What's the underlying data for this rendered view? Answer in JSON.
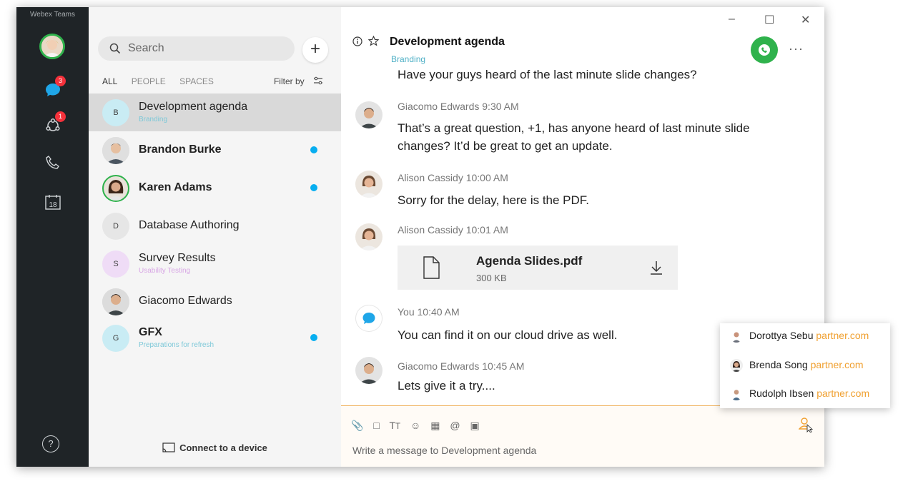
{
  "app": {
    "name": "Webex Teams"
  },
  "rail": {
    "messages_badge": "3",
    "teams_badge": "1",
    "calendar_day": "18",
    "help_glyph": "?"
  },
  "sidebar": {
    "search_placeholder": "Search",
    "add_label": "+",
    "filters": [
      "ALL",
      "PEOPLE",
      "SPACES"
    ],
    "filter_by": "Filter by",
    "items": [
      {
        "initial": "B",
        "name": "Development agenda",
        "sub": "Branding"
      },
      {
        "name": "Brandon Burke"
      },
      {
        "name": "Karen Adams"
      },
      {
        "initial": "D",
        "name": "Database Authoring"
      },
      {
        "initial": "S",
        "name": "Survey Results",
        "sub": "Usability Testing"
      },
      {
        "name": "Giacomo Edwards"
      },
      {
        "initial": "G",
        "name": "GFX",
        "sub": "Preparations for refresh"
      }
    ],
    "connect": "Connect to a device"
  },
  "header": {
    "title": "Development agenda",
    "subtitle": "Branding",
    "more": "···"
  },
  "window_controls": {
    "minimize": "–",
    "maximize": "☐",
    "close": "✕"
  },
  "messages": [
    {
      "text": "Have your guys heard of the last minute slide changes?"
    },
    {
      "meta": "Giacomo Edwards  9:30 AM",
      "text": "That’s a great question, +1, has anyone heard of last minute slide changes? It’d be great to get an update."
    },
    {
      "meta": "Alison Cassidy  10:00 AM",
      "text": "Sorry for the delay, here is the PDF."
    },
    {
      "meta": "Alison Cassidy 10:01 AM"
    },
    {
      "meta": "You  10:40 AM",
      "text": "You can find it on our cloud drive as well."
    },
    {
      "meta": "Giacomo Edwards  10:45 AM",
      "text": "Lets give it a try...."
    }
  ],
  "file": {
    "name": "Agenda Slides.pdf",
    "size": "300 KB"
  },
  "composer": {
    "placeholder": "Write a message to Development agenda"
  },
  "mentions": [
    {
      "name": "Dorottya Sebu",
      "domain": "partner.com"
    },
    {
      "name": "Brenda Song",
      "domain": "partner.com"
    },
    {
      "name": "Rudolph Ibsen",
      "domain": "partner.com"
    }
  ],
  "colors": {
    "accent_green": "#2fb24c",
    "badge_red": "#f5313b",
    "unread_blue": "#07aef0",
    "domain_orange": "#f0a030"
  }
}
